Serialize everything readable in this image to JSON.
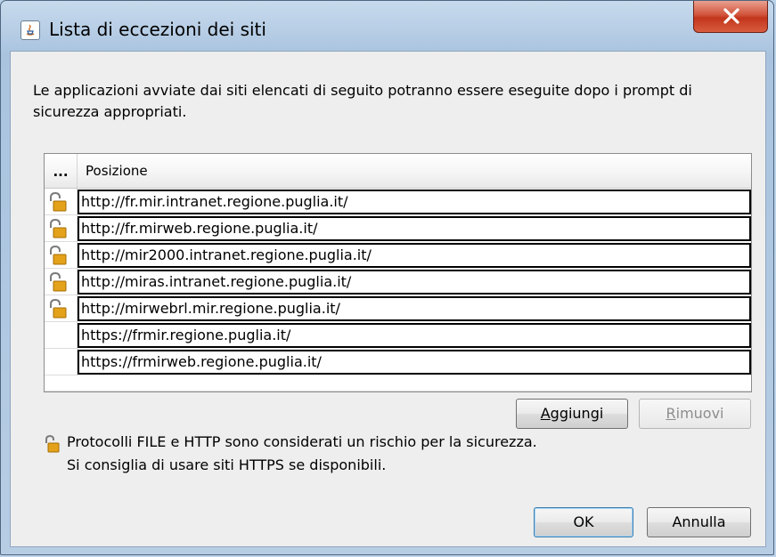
{
  "window": {
    "title": "Lista di eccezioni dei siti"
  },
  "description": "Le applicazioni avviate dai siti elencati di seguito potranno essere eseguite dopo i prompt di sicurezza appropriati.",
  "table": {
    "columns": [
      "...",
      "Posizione"
    ],
    "rows": [
      {
        "icon": "unlocked-padlock-icon",
        "url": "http://fr.mir.intranet.regione.puglia.it/"
      },
      {
        "icon": "unlocked-padlock-icon",
        "url": "http://fr.mirweb.regione.puglia.it/"
      },
      {
        "icon": "unlocked-padlock-icon",
        "url": "http://mir2000.intranet.regione.puglia.it/"
      },
      {
        "icon": "unlocked-padlock-icon",
        "url": "http://miras.intranet.regione.puglia.it/"
      },
      {
        "icon": "unlocked-padlock-icon",
        "url": "http://mirwebrl.mir.regione.puglia.it/"
      },
      {
        "icon": "",
        "url": "https://frmir.regione.puglia.it/"
      },
      {
        "icon": "",
        "url": "https://frmirweb.regione.puglia.it/"
      }
    ]
  },
  "buttons": {
    "add_prefix": "",
    "add_mnemonic": "A",
    "add_rest": "ggiungi",
    "remove_mnemonic": "R",
    "remove_rest": "imuovi",
    "ok": "OK",
    "cancel": "Annulla"
  },
  "warning": {
    "line1": "Protocolli FILE e HTTP sono considerati un rischio per la sicurezza.",
    "line2": "Si consiglia di usare siti HTTPS se disponibili."
  },
  "colors": {
    "close_button": "#c7432a",
    "padlock": "#e3a21a"
  }
}
